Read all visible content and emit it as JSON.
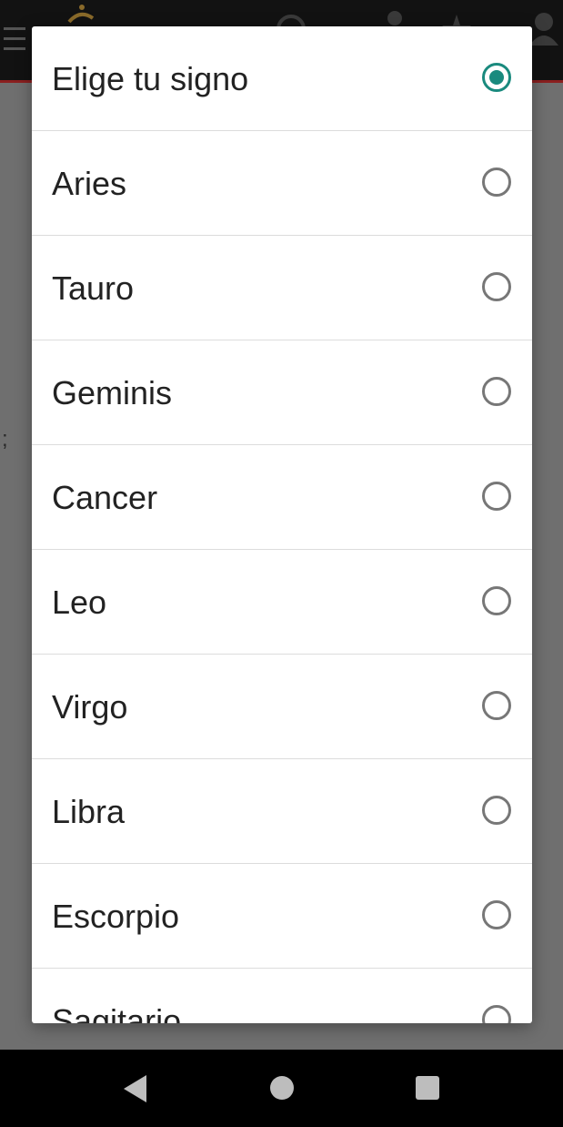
{
  "dialog": {
    "options": [
      {
        "label": "Elige tu signo",
        "checked": true
      },
      {
        "label": "Aries",
        "checked": false
      },
      {
        "label": "Tauro",
        "checked": false
      },
      {
        "label": "Geminis",
        "checked": false
      },
      {
        "label": "Cancer",
        "checked": false
      },
      {
        "label": "Leo",
        "checked": false
      },
      {
        "label": "Virgo",
        "checked": false
      },
      {
        "label": "Libra",
        "checked": false
      },
      {
        "label": "Escorpio",
        "checked": false
      },
      {
        "label": "Sagitario",
        "checked": false
      }
    ]
  },
  "background": {
    "partial_text": ";"
  },
  "colors": {
    "accent": "#1a8a7e",
    "scrim": "#6b6b6b",
    "toolbar_border": "#8a1f1f"
  },
  "icons": {
    "toolbar": [
      "menu-icon",
      "logo-icon",
      "search-icon",
      "user-icon",
      "star-icon",
      "account-icon"
    ],
    "navigation": [
      "back-icon",
      "home-icon",
      "recents-icon"
    ]
  }
}
